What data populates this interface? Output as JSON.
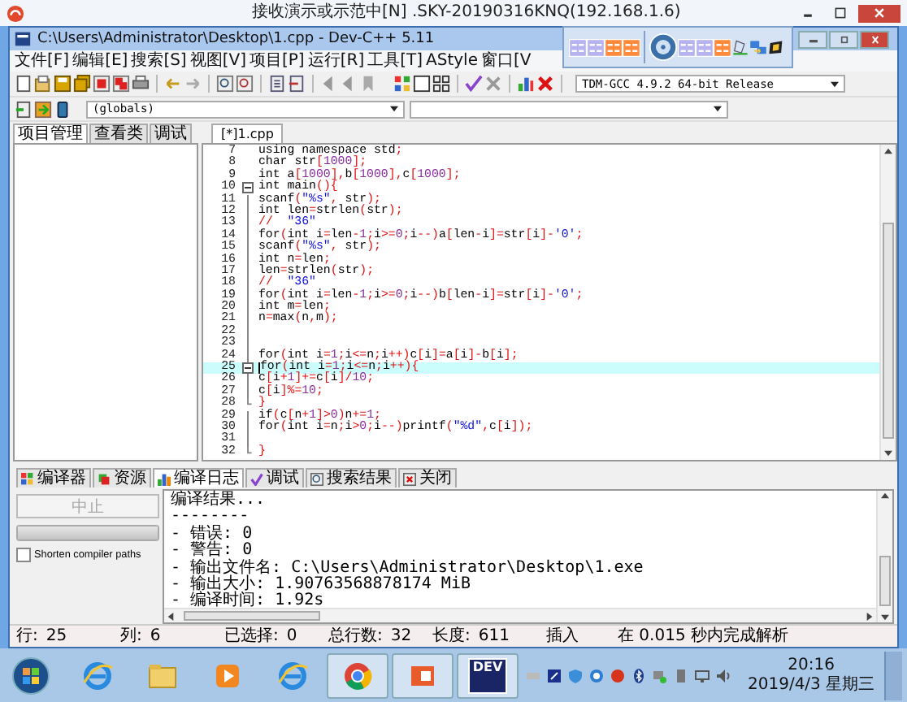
{
  "broadcast_title": "接收演示或示范中[N] .SKY-20190316KNQ(192.168.1.6)",
  "window": {
    "title": "C:\\Users\\Administrator\\Desktop\\1.cpp - Dev-C++ 5.11"
  },
  "menu": [
    "文件[F]",
    "编辑[E]",
    "搜索[S]",
    "视图[V]",
    "项目[P]",
    "运行[R]",
    "工具[T]",
    "AStyle",
    "窗口[V"
  ],
  "compiler_dropdown": {
    "value": "TDM-GCC 4.9.2 64-bit Release"
  },
  "scope_dropdown": {
    "value": "(globals)"
  },
  "side_tabs": [
    {
      "label": "项目管理",
      "selected": true
    },
    {
      "label": "查看类",
      "selected": false
    },
    {
      "label": "调试",
      "selected": false
    }
  ],
  "editor_tabs": [
    {
      "label": "[*]1.cpp",
      "selected": true
    }
  ],
  "code_lines": [
    {
      "number": "7",
      "code": "using namespace std;",
      "current": false
    },
    {
      "number": "8",
      "code": "char str[1000];",
      "current": false
    },
    {
      "number": "9",
      "code": "int a[1000],b[1000],c[1000];",
      "current": false
    },
    {
      "number": "10",
      "code": "int main(){",
      "current": false,
      "kind": "open"
    },
    {
      "number": "11",
      "code": "    scanf(\"%s\", str);",
      "current": false
    },
    {
      "number": "12",
      "code": "    int len=strlen(str);",
      "current": false
    },
    {
      "number": "13",
      "code": "    //  \"36\"",
      "current": false
    },
    {
      "number": "14",
      "code": "    for(int i=len-1;i>=0;i--)a[len-i]=str[i]-'0';",
      "current": false
    },
    {
      "number": "15",
      "code": "    scanf(\"%s\", str);",
      "current": false
    },
    {
      "number": "16",
      "code": "    int n=len;",
      "current": false
    },
    {
      "number": "17",
      "code": "    len=strlen(str);",
      "current": false
    },
    {
      "number": "18",
      "code": "    //  \"36\"",
      "current": false
    },
    {
      "number": "19",
      "code": "    for(int i=len-1;i>=0;i--)b[len-i]=str[i]-'0';",
      "current": false
    },
    {
      "number": "20",
      "code": "    int m=len;",
      "current": false
    },
    {
      "number": "21",
      "code": "    n=max(n,m);",
      "current": false
    },
    {
      "number": "22",
      "current": false
    },
    {
      "number": "23",
      "current": false
    },
    {
      "number": "24",
      "code": "    for(int i=1;i<=n;i++)c[i]=a[i]-b[i];",
      "current": false
    },
    {
      "number": "25",
      "code": "    for(int i=1;i<=n;i++){",
      "current": true,
      "kind": "open"
    },
    {
      "number": "26",
      "code": "        c[i+1]+=c[i]/10;",
      "current": false
    },
    {
      "number": "27",
      "code": "        c[i]%=10;",
      "current": false
    },
    {
      "number": "28",
      "code": "    }",
      "current": false,
      "kind": "close"
    },
    {
      "number": "29",
      "code": "    if(c[n+1]>0)n+=1;",
      "current": false
    },
    {
      "number": "30",
      "code": "    for(int i=n;i>0;i--)printf(\"%d\",c[i]);",
      "current": false
    },
    {
      "number": "31",
      "current": false
    },
    {
      "number": "32",
      "code": "}",
      "current": false,
      "kind": "close"
    }
  ],
  "log_tabs": [
    {
      "label": "编译器",
      "selected": false
    },
    {
      "label": "资源",
      "selected": false
    },
    {
      "label": "编译日志",
      "selected": true
    },
    {
      "label": "调试",
      "selected": false
    },
    {
      "label": "搜索结果",
      "selected": false
    },
    {
      "label": "关闭",
      "selected": false
    }
  ],
  "abort_button": {
    "label": "中止",
    "disabled": true
  },
  "progress": {
    "level": 1
  },
  "shorten_paths": {
    "label": "Shorten compiler paths",
    "checked": false
  },
  "log_lines": [
    "编译结果...",
    "--------",
    "- 错误: 0",
    "- 警告: 0",
    "- 输出文件名: C:\\Users\\Administrator\\Desktop\\1.exe",
    "- 输出大小: 1.90763568878174 MiB",
    "- 编译时间: 1.92s"
  ],
  "status_bar": [
    {
      "label": "行:",
      "value": "25"
    },
    {
      "label": "列:",
      "value": "6"
    },
    {
      "label": "已选择:",
      "value": "0"
    },
    {
      "label": "总行数:",
      "value": "32"
    },
    {
      "label": "长度:",
      "value": "611"
    }
  ],
  "insert_mode": "插入",
  "parse_message": "在 0.015 秒内完成解析",
  "taskbar": {
    "apps": [
      {
        "kind": "ie",
        "active": false
      },
      {
        "kind": "folder",
        "active": false
      },
      {
        "kind": "player",
        "active": false
      },
      {
        "kind": "ie",
        "active": false
      },
      {
        "kind": "chrome",
        "active": true
      },
      {
        "kind": "slides",
        "active": true
      },
      {
        "kind": "dev",
        "active": true,
        "label": "DEV"
      }
    ],
    "time": "20:16",
    "date": "2019/4/3 星期三"
  }
}
